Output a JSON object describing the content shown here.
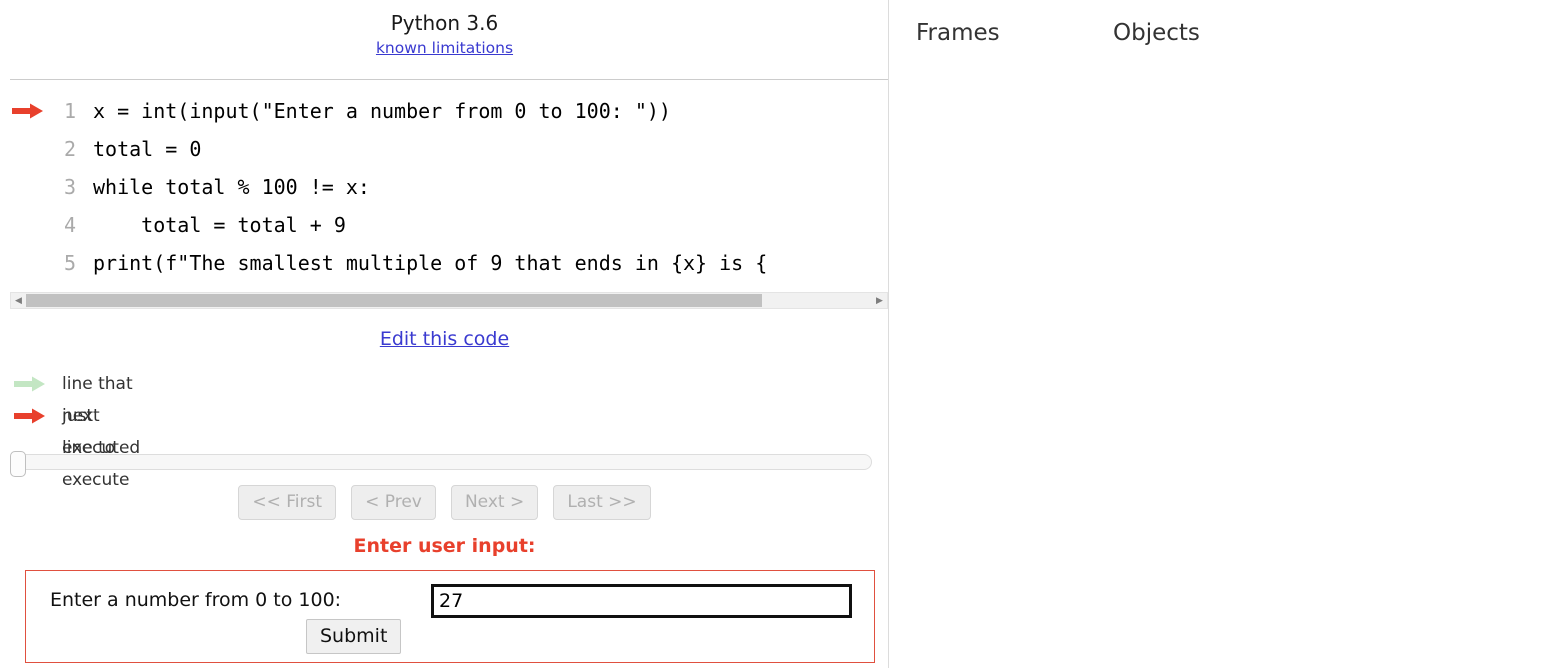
{
  "header": {
    "version_title": "Python 3.6",
    "limitations_link": "known limitations"
  },
  "code": {
    "lines": [
      {
        "number": "1",
        "text": "x = int(input(\"Enter a number from 0 to 100: \"))",
        "arrow": "next"
      },
      {
        "number": "2",
        "text": "total = 0",
        "arrow": "none"
      },
      {
        "number": "3",
        "text": "while total % 100 != x:",
        "arrow": "none"
      },
      {
        "number": "4",
        "text": "    total = total + 9",
        "arrow": "none"
      },
      {
        "number": "5",
        "text": "print(f\"The smallest multiple of 9 that ends in {x} is {",
        "arrow": "none"
      }
    ],
    "scroll_thumb_percent": "87"
  },
  "edit_link": "Edit this code",
  "legend": {
    "just_executed": "line that just executed",
    "next_line": "next line to execute"
  },
  "nav": {
    "first": "<< First",
    "prev": "< Prev",
    "next": "Next >",
    "last": "Last >>"
  },
  "user_input": {
    "title": "Enter user input:",
    "prompt": "Enter a number from 0 to 100:",
    "value": "27",
    "placeholder": "",
    "submit_label": "Submit"
  },
  "viz": {
    "frames_heading": "Frames",
    "objects_heading": "Objects"
  },
  "colors": {
    "next_arrow": "#e8402c",
    "executed_arrow": "#c3e6c3",
    "link": "#3a3ad0",
    "prompt_accent": "#e8402c",
    "lineno": "#aaaaaa",
    "divider": "#dcdcdc"
  }
}
